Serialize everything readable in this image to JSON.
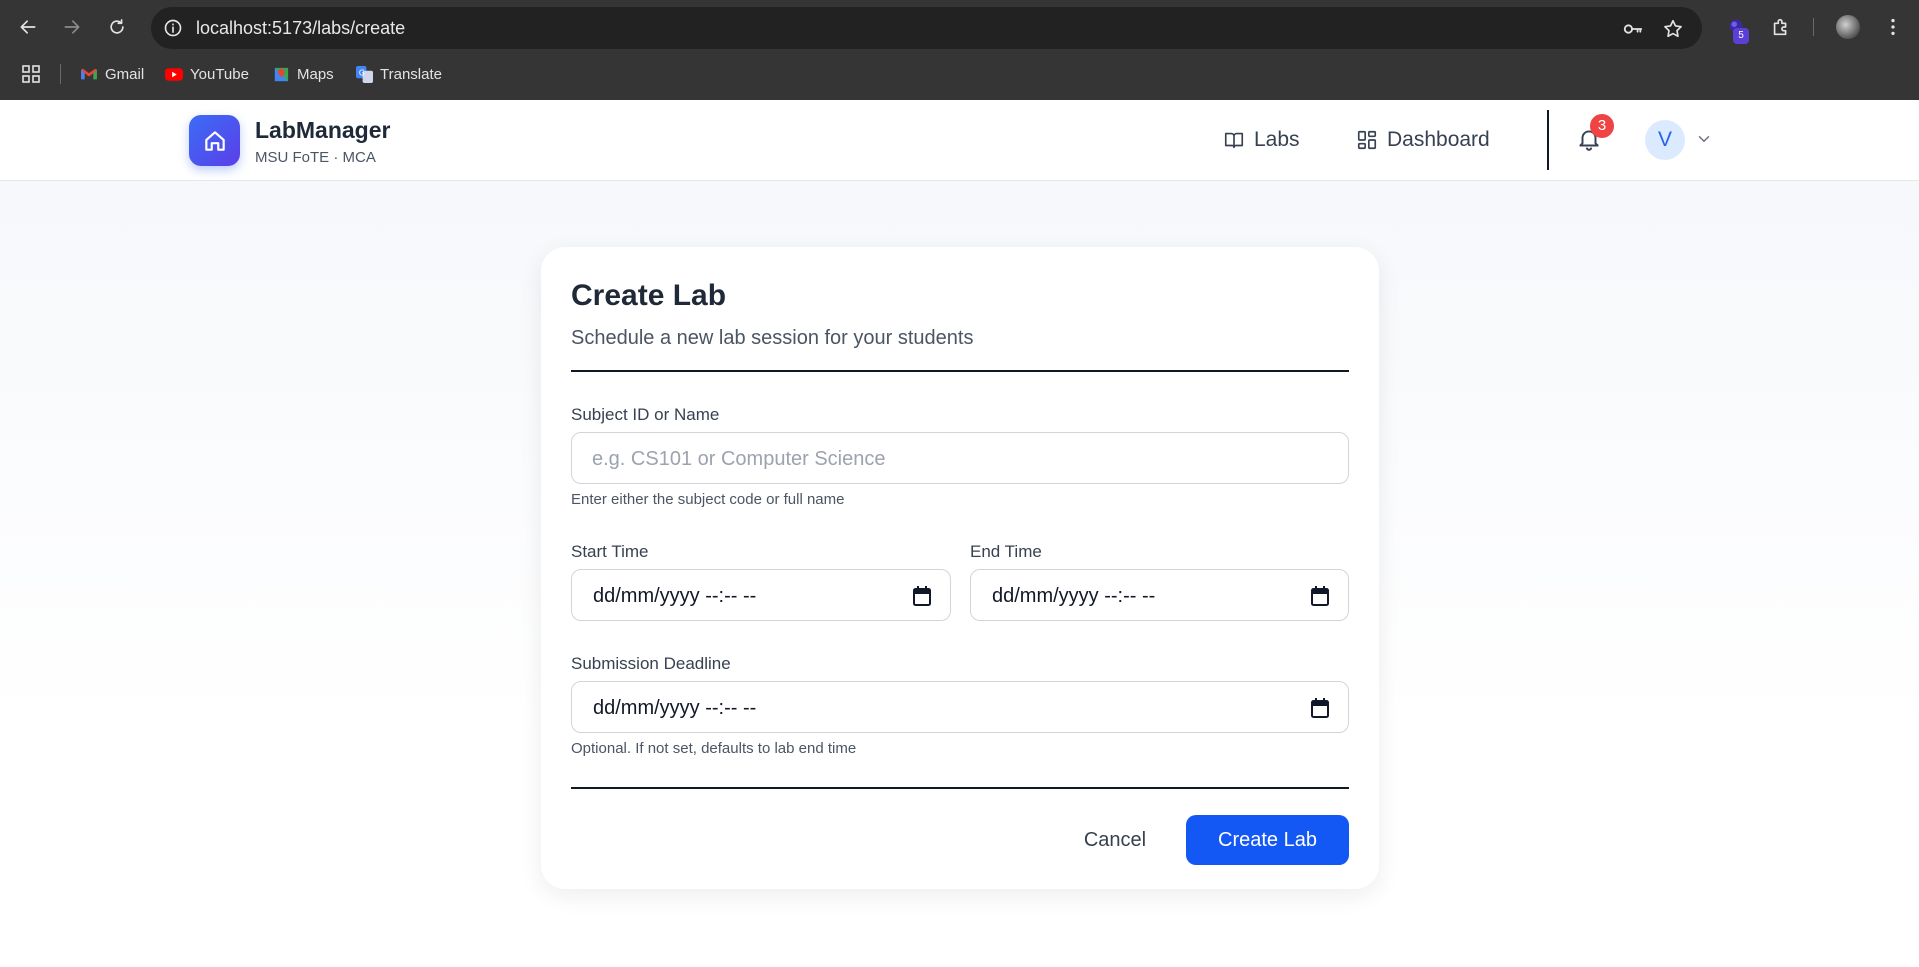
{
  "browser": {
    "url": "localhost:5173/labs/create",
    "extension_badge": "5",
    "bookmarks": [
      {
        "label": "Gmail",
        "icon": "gmail-icon"
      },
      {
        "label": "YouTube",
        "icon": "youtube-icon"
      },
      {
        "label": "Maps",
        "icon": "maps-icon"
      },
      {
        "label": "Translate",
        "icon": "translate-icon"
      }
    ]
  },
  "header": {
    "brand_title": "LabManager",
    "brand_subtitle": "MSU FoTE · MCA",
    "nav": [
      {
        "label": "Labs",
        "icon": "book-open-icon"
      },
      {
        "label": "Dashboard",
        "icon": "dashboard-grid-icon"
      }
    ],
    "notification_count": "3",
    "avatar_initial": "V",
    "colors": {
      "brand_gradient_start": "#3b6cf6",
      "brand_gradient_end": "#5b3fe8",
      "badge": "#ef4444"
    }
  },
  "form": {
    "title": "Create Lab",
    "subtitle": "Schedule a new lab session for your students",
    "subject": {
      "label": "Subject ID or Name",
      "placeholder": "e.g. CS101 or Computer Science",
      "hint": "Enter either the subject code or full name"
    },
    "start_time": {
      "label": "Start Time",
      "value": "dd/mm/yyyy --:-- --"
    },
    "end_time": {
      "label": "End Time",
      "value": "dd/mm/yyyy --:-- --"
    },
    "deadline": {
      "label": "Submission Deadline",
      "value": "dd/mm/yyyy --:-- --",
      "hint": "Optional. If not set, defaults to lab end time"
    },
    "cancel_label": "Cancel",
    "submit_label": "Create Lab",
    "colors": {
      "primary": "#1358f5"
    }
  }
}
